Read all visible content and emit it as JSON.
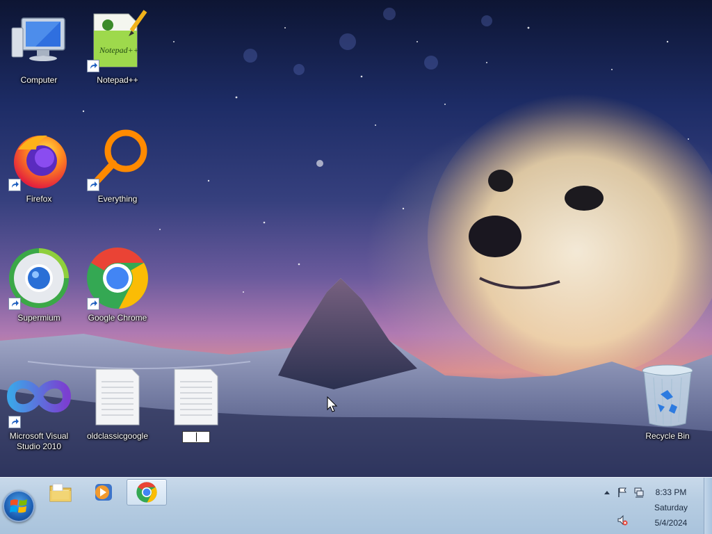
{
  "desktop": {
    "icons": [
      {
        "label": "Computer",
        "icon": "computer-icon",
        "shortcut": false
      },
      {
        "label": "Notepad++",
        "icon": "notepad-plus-plus-icon",
        "shortcut": true
      },
      {
        "label": "Firefox",
        "icon": "firefox-icon",
        "shortcut": true
      },
      {
        "label": "Everything",
        "icon": "everything-search-icon",
        "shortcut": true
      },
      {
        "label": "Supermium",
        "icon": "supermium-icon",
        "shortcut": true
      },
      {
        "label": "Google Chrome",
        "icon": "chrome-icon",
        "shortcut": true
      },
      {
        "label": "Microsoft Visual Studio 2010",
        "icon": "visual-studio-icon",
        "shortcut": true
      },
      {
        "label": "oldclassicgoogle",
        "icon": "text-file-icon",
        "shortcut": false
      },
      {
        "label": "",
        "icon": "text-file-icon",
        "shortcut": false,
        "renaming": true
      },
      {
        "label": "Recycle Bin",
        "icon": "recycle-bin-icon",
        "shortcut": false
      }
    ]
  },
  "taskbar": {
    "start": {
      "icon": "windows-start-orb-icon"
    },
    "pinned": [
      {
        "name": "File Explorer",
        "icon": "folder-icon",
        "active": false
      },
      {
        "name": "Windows Media Player",
        "icon": "media-player-icon",
        "active": false
      },
      {
        "name": "Google Chrome",
        "icon": "chrome-icon",
        "active": true
      }
    ],
    "tray": {
      "icons": [
        "show-hidden-icons-chevron-icon",
        "action-center-flag-icon",
        "network-icon",
        "volume-muted-icon"
      ],
      "time": "8:33 PM",
      "day": "Saturday",
      "date": "5/4/2024"
    }
  },
  "colors": {
    "taskbar": "#b7cde2",
    "label_text": "#ffffff",
    "clock_text": "#1b2a3f"
  }
}
